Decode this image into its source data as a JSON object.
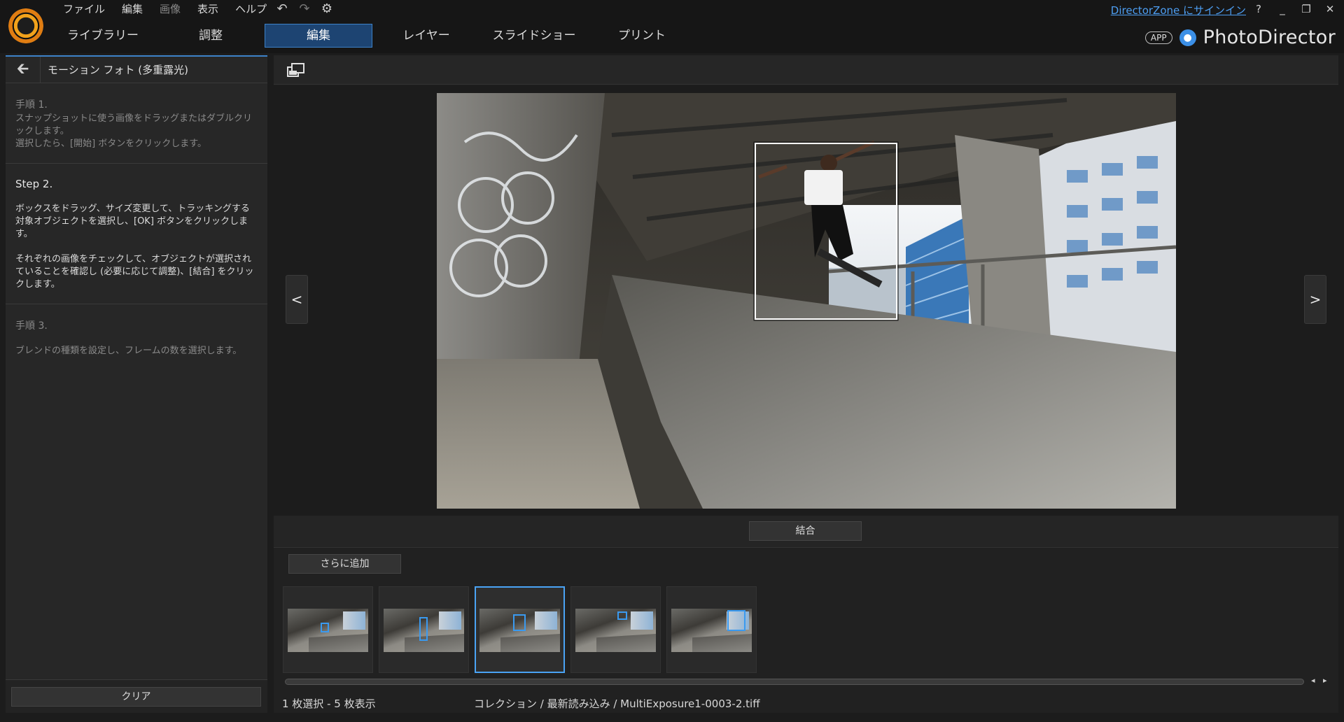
{
  "menu": {
    "items": [
      {
        "label": "ファイル",
        "dim": false
      },
      {
        "label": "編集",
        "dim": false
      },
      {
        "label": "画像",
        "dim": true
      },
      {
        "label": "表示",
        "dim": false
      },
      {
        "label": "ヘルプ",
        "dim": false
      }
    ]
  },
  "history": {
    "undo": "↶",
    "redo": "↷",
    "settings": "⚙"
  },
  "modes": {
    "library": "ライブラリー",
    "adjust": "調整",
    "edit": "編集",
    "layers": "レイヤー",
    "slideshow": "スライドショー",
    "print": "プリント",
    "active": "edit"
  },
  "account": {
    "signin": "DirectorZone にサインイン"
  },
  "window": {
    "help": "?",
    "minimize": "_",
    "restore": "❐",
    "close": "✕"
  },
  "brand": {
    "app_badge": "APP",
    "name": "PhotoDirector"
  },
  "panel": {
    "title": "モーション フォト (多重露光)",
    "steps": [
      {
        "title": "手順 1.",
        "text": "スナップショットに使う画像をドラッグまたはダブルクリックします。\n選択したら、[開始] ボタンをクリックします。",
        "active": false
      },
      {
        "title": "Step 2.",
        "text": "ボックスをドラッグ、サイズ変更して、トラッキングする対象オブジェクトを選択し、[OK] ボタンをクリックします。",
        "text2": "それぞれの画像をチェックして、オブジェクトが選択されていることを確認し (必要に応じて調整)、[結合] をクリックします。",
        "active": true
      },
      {
        "title": "手順 3.",
        "text": "ブレンドの種類を設定し、フレームの数を選択します。",
        "active": false
      }
    ],
    "clear_label": "クリア"
  },
  "viewer": {
    "prev_label": "<",
    "next_label": ">",
    "combine_label": "結合"
  },
  "filmstrip": {
    "add_more_label": "さらに追加",
    "thumbnails": [
      {
        "selected": false
      },
      {
        "selected": false
      },
      {
        "selected": true
      },
      {
        "selected": false
      },
      {
        "selected": false
      }
    ],
    "scroll_arrows": "◂ ▸"
  },
  "status": {
    "count": "1 枚選択 - 5 枚表示",
    "path": "コレクション / 最新読み込み / MultiExposure1-0003-2.tiff"
  },
  "colors": {
    "accent": "#3d82c9",
    "active_tab_bg": "#1d4472",
    "selection_box": "#3a9af0",
    "link": "#4d9ef2"
  }
}
